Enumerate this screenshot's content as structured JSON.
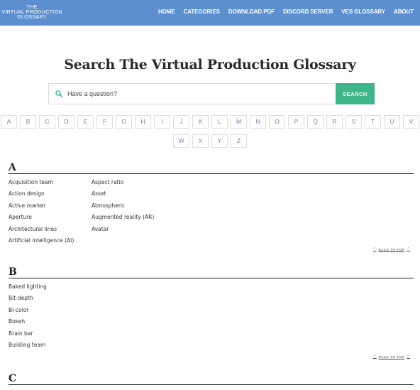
{
  "header": {
    "logo": [
      "THE",
      "VIRTUAL PRODUCTION",
      "GLOSSARY"
    ],
    "nav": [
      "HOME",
      "CATEGORIES",
      "DOWNLOAD PDF",
      "DISCORD SERVER",
      "VES GLOSSARY",
      "ABOUT"
    ],
    "bg_color": "#5b8fd0"
  },
  "page_title": "Search The Virtual Production Glossary",
  "search": {
    "placeholder": "Have a question?",
    "button_label": "SEARCH",
    "button_color": "#3fb58a"
  },
  "alphabet": {
    "row1": [
      "A",
      "B",
      "C",
      "D",
      "E",
      "F",
      "G",
      "H",
      "I",
      "J",
      "K",
      "L",
      "M",
      "N",
      "O",
      "P",
      "Q",
      "R",
      "S",
      "T",
      "U",
      "V"
    ],
    "row2": [
      "W",
      "X",
      "Y",
      "Z"
    ]
  },
  "sections": [
    {
      "letter": "A",
      "col1": [
        "Acquisition team",
        "Action design",
        "Active marker",
        "Aperture",
        "Architectural lines",
        "Artificial intelligence (AI)"
      ],
      "col2": [
        "Aspect ratio",
        "Asset",
        "Atmospheric",
        "Augmented reality (AR)",
        "Avatar"
      ],
      "back_to_top": "BACK TO TOP"
    },
    {
      "letter": "B",
      "col1": [
        "Baked lighting",
        "Bit-depth",
        "Bi-color",
        "Bokeh",
        "Brain bar",
        "Building team"
      ],
      "back_to_top": "BACK TO TOP"
    },
    {
      "letter": "C"
    }
  ]
}
